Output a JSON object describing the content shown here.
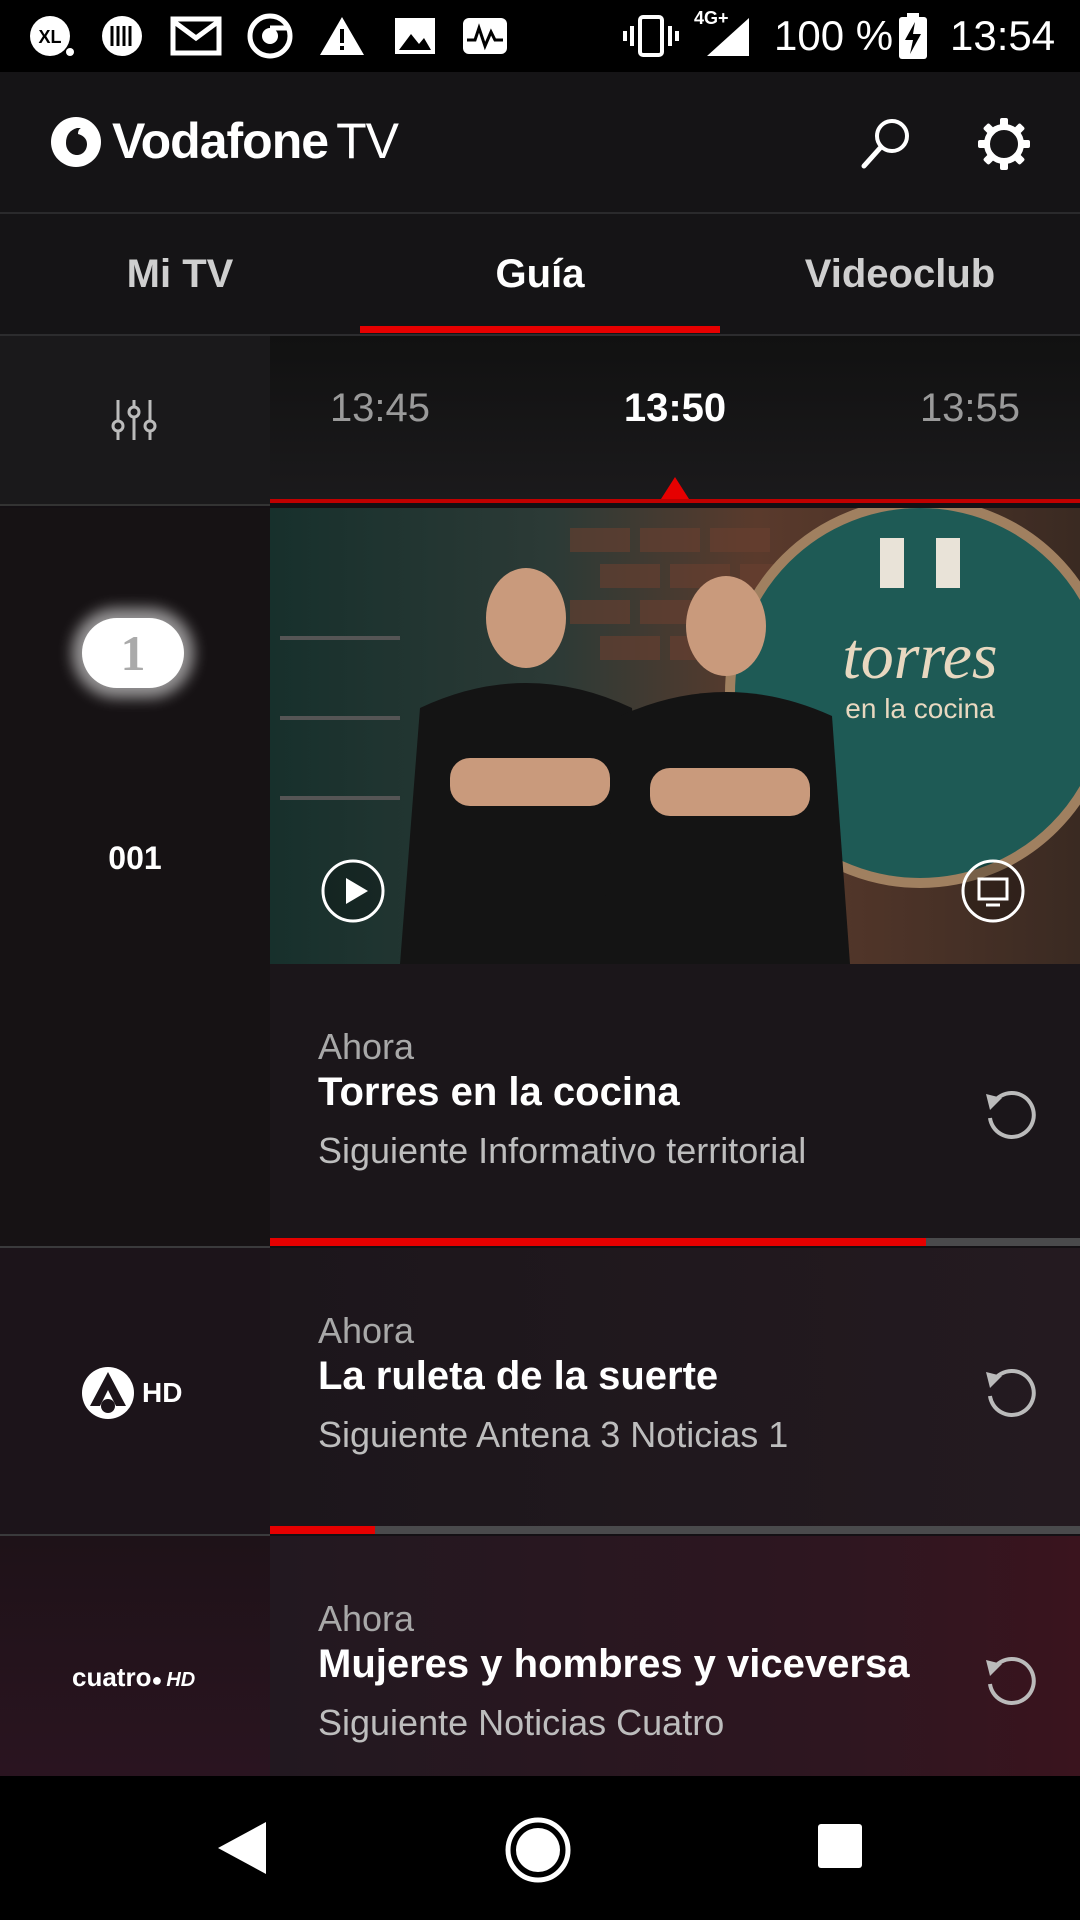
{
  "status_bar": {
    "carrier": "XL",
    "network": "4G+",
    "battery": "100 %",
    "time": "13:54",
    "icons": [
      "xl-icon",
      "barcode-icon",
      "gmail-icon",
      "chrome-icon",
      "warning-icon",
      "image-icon",
      "activity-icon",
      "vibrate-icon",
      "signal-icon",
      "battery-charging-icon"
    ]
  },
  "header": {
    "brand": "Vodafone",
    "brand_suffix": "TV",
    "icons": [
      "vodafone-logo-icon",
      "search-icon",
      "gear-icon"
    ]
  },
  "tabs": [
    {
      "label": "Mi TV",
      "active": false
    },
    {
      "label": "Guía",
      "active": true
    },
    {
      "label": "Videoclub",
      "active": false
    }
  ],
  "timeline": {
    "filter_icon": "sliders-icon",
    "times": [
      "13:45",
      "13:50",
      "13:55"
    ],
    "current_index": 1
  },
  "channels": [
    {
      "logo": "La 1 HD",
      "logo_icon": "la1-hd-logo-icon",
      "number": "001",
      "ahora_label": "Ahora",
      "title": "Torres en la cocina",
      "next": "Siguiente Informativo territorial",
      "progress": 0.81,
      "thumbnail": {
        "sign_word": "torres",
        "sign_sub": "en la cocina",
        "play_icon": "play-icon",
        "tv_icon": "tv-icon"
      }
    },
    {
      "logo": "HD",
      "logo_icon": "antena3-logo-icon",
      "ahora_label": "Ahora",
      "title": "La ruleta de la suerte",
      "next": "Siguiente Antena 3 Noticias 1",
      "progress": 0.13
    },
    {
      "logo": "cuatro",
      "logo_suffix": "HD",
      "logo_icon": "cuatro-logo-icon",
      "ahora_label": "Ahora",
      "title": "Mujeres y hombres y viceversa",
      "next": "Siguiente Noticias Cuatro"
    }
  ],
  "navbar": {
    "icons": [
      "back-icon",
      "home-icon",
      "recents-icon"
    ]
  },
  "colors": {
    "accent": "#e60000",
    "background": "#141014"
  }
}
